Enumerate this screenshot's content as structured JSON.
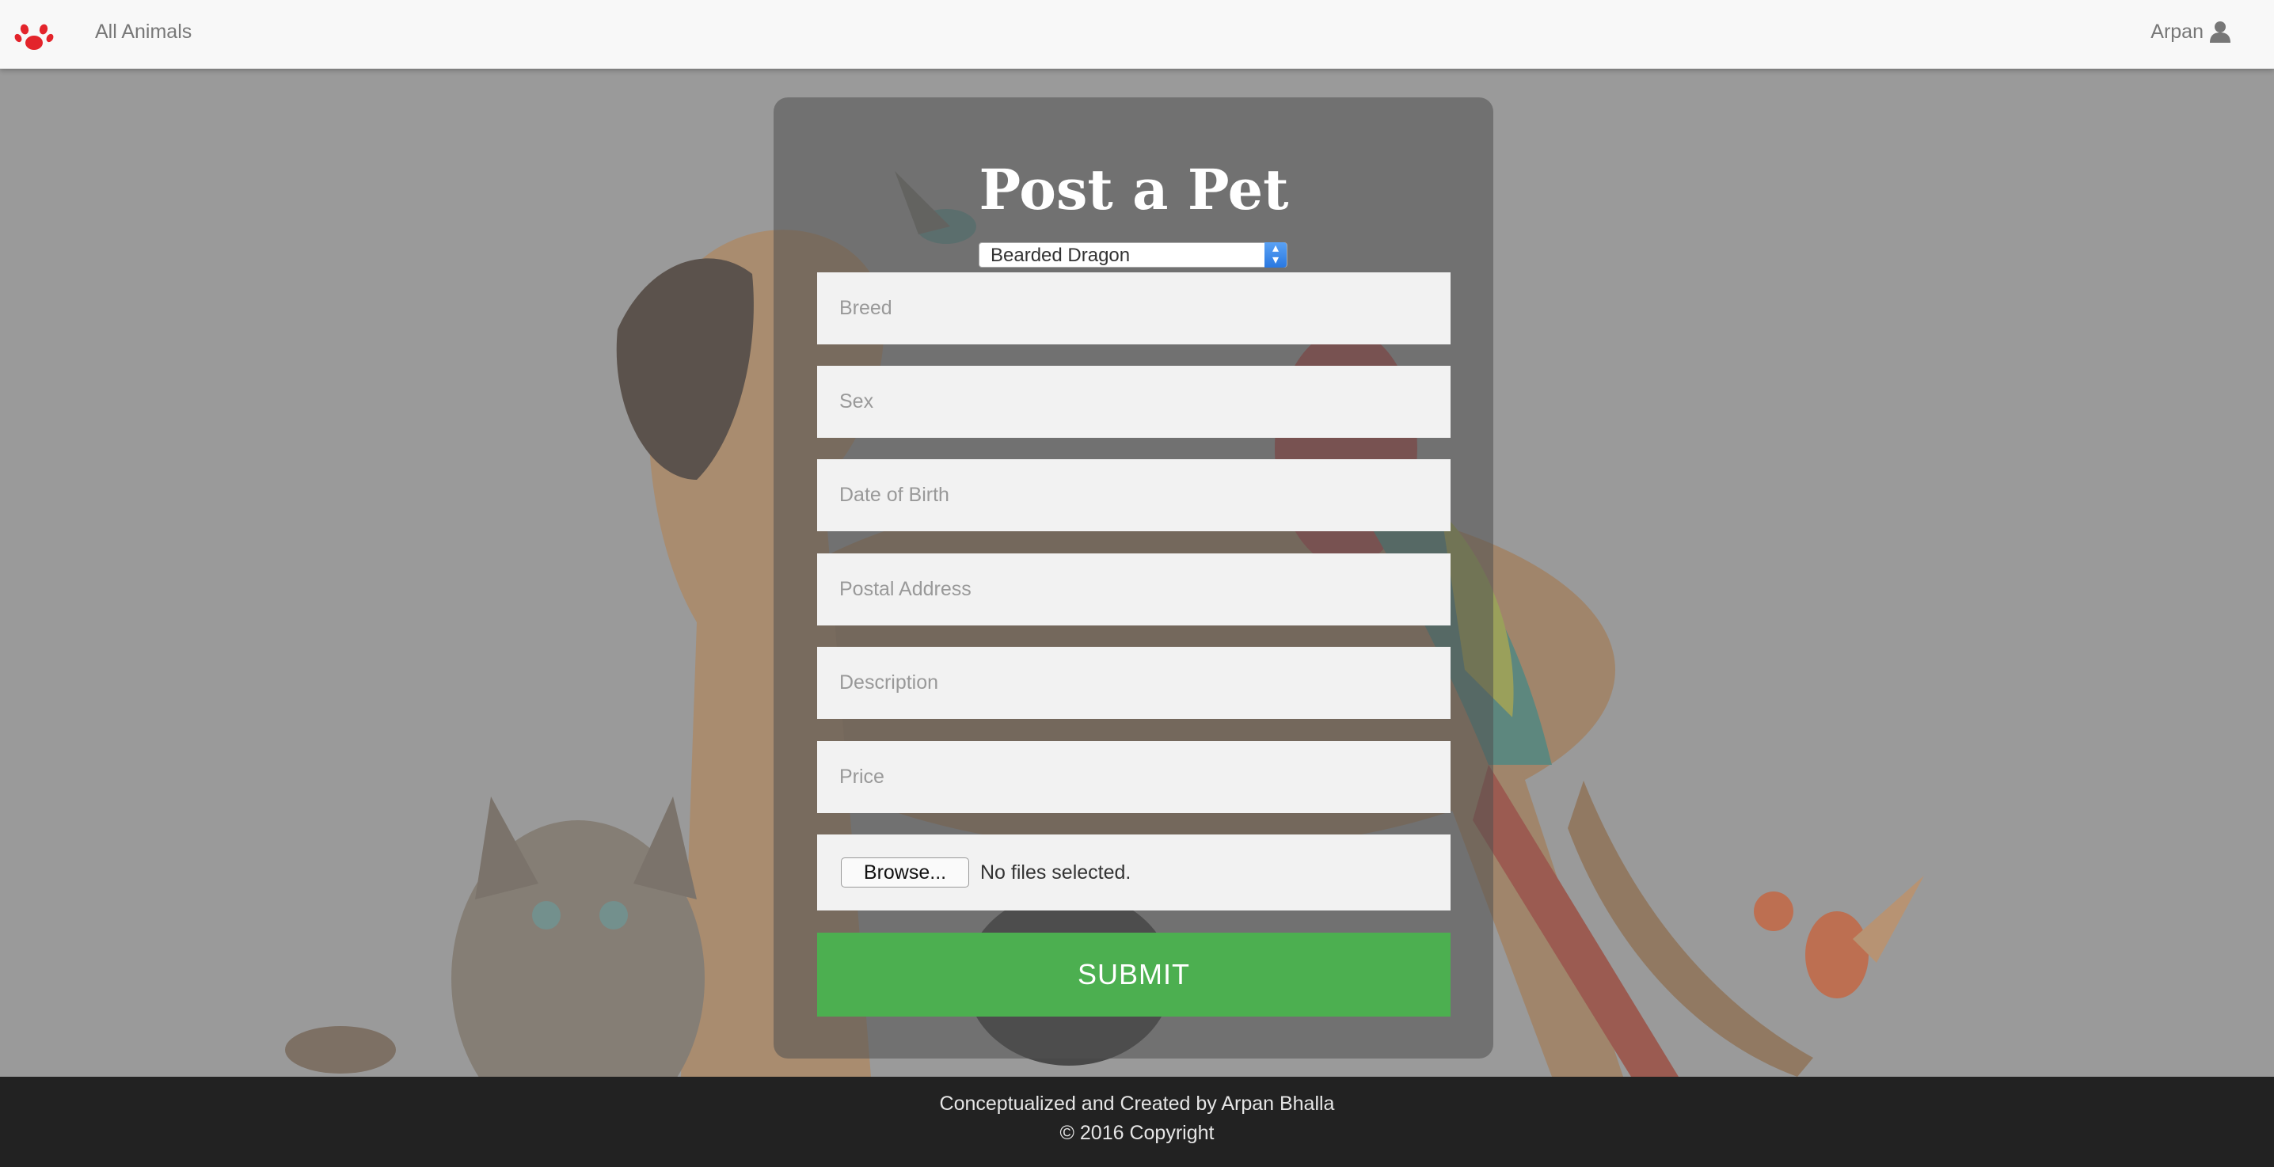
{
  "navbar": {
    "logo_icon": "paw-icon",
    "brand_color": "#e3242b",
    "nav_link": "All Animals",
    "user_name": "Arpan",
    "user_icon": "user-icon"
  },
  "form": {
    "title": "Post a Pet",
    "animal_select": {
      "selected": "Bearded Dragon"
    },
    "fields": {
      "breed_placeholder": "Breed",
      "sex_placeholder": "Sex",
      "dob_placeholder": "Date of Birth",
      "address_placeholder": "Postal Address",
      "description_placeholder": "Description",
      "price_placeholder": "Price"
    },
    "file": {
      "browse_label": "Browse...",
      "status": "No files selected."
    },
    "submit_label": "SUBMIT",
    "submit_color": "#4caf50"
  },
  "footer": {
    "credit": "Conceptualized and Created by Arpan Bhalla",
    "copyright": "© 2016 Copyright"
  }
}
